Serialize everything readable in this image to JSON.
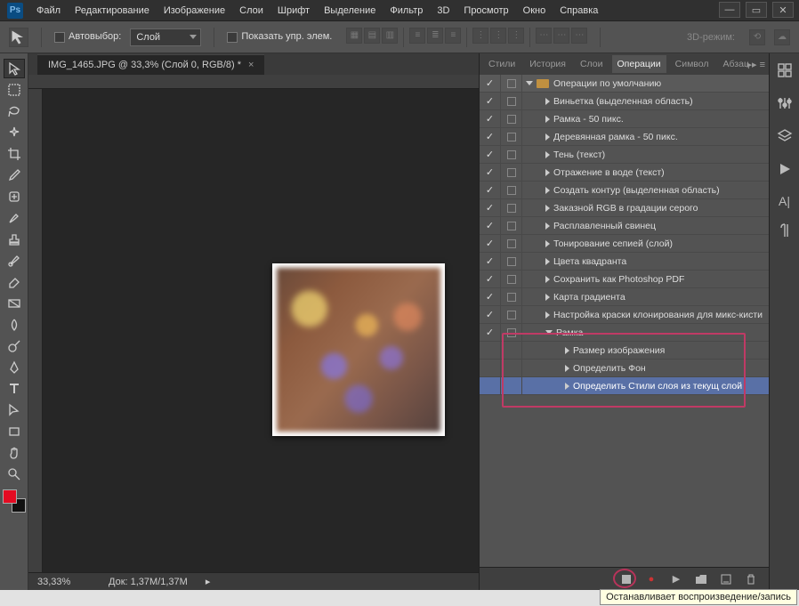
{
  "menu": [
    "Файл",
    "Редактирование",
    "Изображение",
    "Слои",
    "Шрифт",
    "Выделение",
    "Фильтр",
    "3D",
    "Просмотр",
    "Окно",
    "Справка"
  ],
  "options": {
    "auto_select": "Автовыбор:",
    "layer_dd": "Слой",
    "show_controls": "Показать упр. элем.",
    "mode3d": "3D-режим:"
  },
  "doc": {
    "tab": "IMG_1465.JPG @ 33,3% (Слой 0, RGB/8) *"
  },
  "status": {
    "zoom": "33,33%",
    "doc": "Док: 1,37M/1,37M"
  },
  "panels": {
    "tabs": [
      "Стили",
      "История",
      "Слои",
      "Операции",
      "Символ",
      "Абзац"
    ],
    "active": 3
  },
  "actions": {
    "folder": "Операции по умолчанию",
    "items": [
      "Виньетка (выделенная область)",
      "Рамка - 50 пикс.",
      "Деревянная рамка - 50 пикс.",
      "Тень (текст)",
      "Отражение в воде (текст)",
      "Создать контур (выделенная область)",
      "Заказной RGB в градации серого",
      "Расплавленный свинец",
      "Тонирование сепией (слой)",
      "Цвета квадранта",
      "Сохранить как Photoshop PDF",
      "Карта градиента",
      "Настройка краски клонирования для микс-кисти"
    ],
    "user_action": "Рамка",
    "steps": [
      "Размер изображения",
      "Определить Фон",
      "Определить Стили слоя из текущ слой"
    ]
  },
  "colors": {
    "fg": "#e40b22",
    "bg": "#111111"
  },
  "tooltip": "Останавливает воспроизведение/запись"
}
